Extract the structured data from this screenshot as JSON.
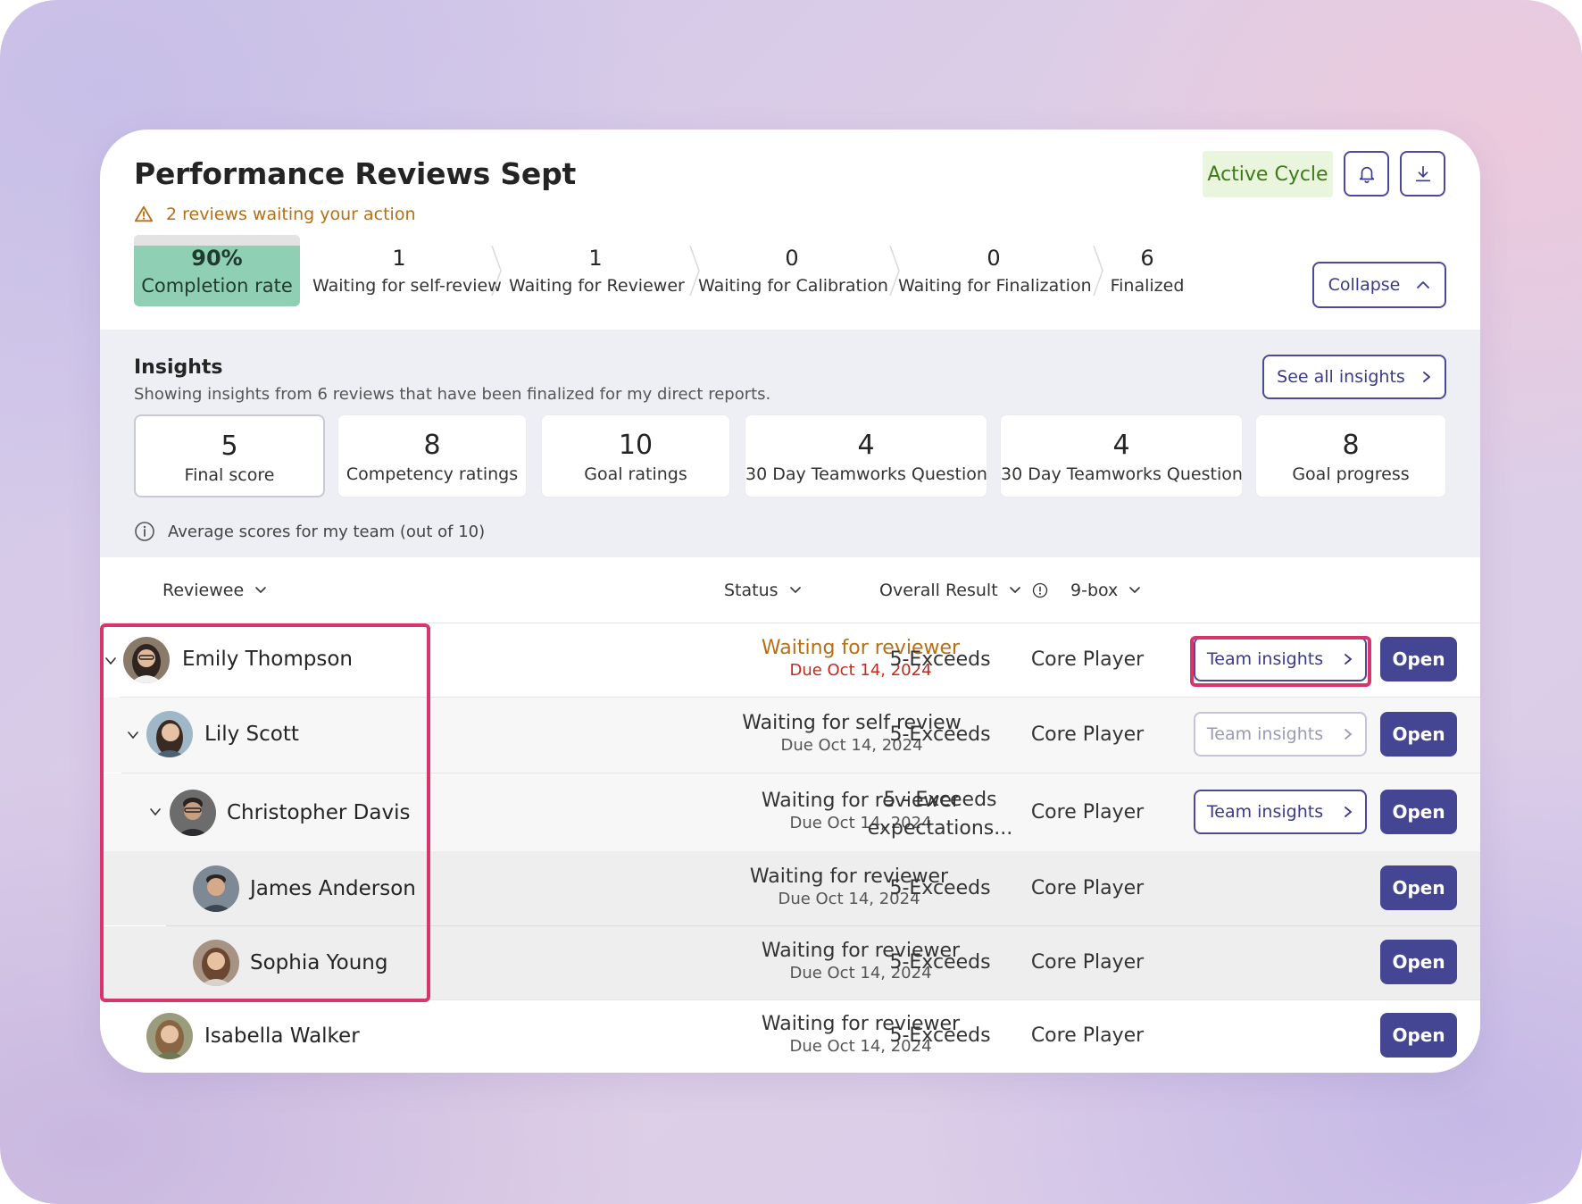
{
  "header": {
    "title": "Performance Reviews Sept",
    "warning": "2 reviews waiting your action",
    "active_cycle": "Active Cycle",
    "bell_icon": "bell-icon",
    "download_icon": "download-icon",
    "collapse_label": "Collapse"
  },
  "colors": {
    "accent": "#444593",
    "completion": "#8fcfb3",
    "warning": "#b86e14",
    "due_overdue": "#c22b1c",
    "highlight": "#d8356b",
    "active_cycle_bg": "#e9f5dd"
  },
  "summary": {
    "completion_value": "90%",
    "completion_label": "Completion rate",
    "stages": [
      {
        "count": "1",
        "label": "Waiting for self-review"
      },
      {
        "count": "1",
        "label": "Waiting for Reviewer"
      },
      {
        "count": "0",
        "label": "Waiting for Calibration"
      },
      {
        "count": "0",
        "label": "Waiting for Finalization"
      },
      {
        "count": "6",
        "label": "Finalized"
      }
    ]
  },
  "insights": {
    "title": "Insights",
    "subtitle": "Showing insights from 6 reviews that have been finalized for my direct reports.",
    "see_all": "See all insights",
    "note": "Average scores for my team (out of 10)",
    "cards": [
      {
        "value": "5",
        "label": "Final score"
      },
      {
        "value": "8",
        "label": "Competency ratings"
      },
      {
        "value": "10",
        "label": "Goal ratings"
      },
      {
        "value": "4",
        "label": "30 Day Teamworks Question"
      },
      {
        "value": "4",
        "label": "30 Day Teamworks Question"
      },
      {
        "value": "8",
        "label": "Goal progress"
      }
    ]
  },
  "table": {
    "columns": {
      "reviewee": "Reviewee",
      "status": "Status",
      "result": "Overall Result",
      "ninebox": "9-box"
    },
    "team_insights_label": "Team insights",
    "open_label": "Open",
    "rows": [
      {
        "name": "Emily Thompson",
        "status": "Waiting for reviewer",
        "due": "Due Oct 14, 2024",
        "result": "5-Exceeds",
        "ninebox": "Core Player"
      },
      {
        "name": "Lily Scott",
        "status": "Waiting for self review",
        "due": "Due Oct 14, 2024",
        "result": "5-Exceeds",
        "ninebox": "Core Player"
      },
      {
        "name": "Christopher Davis",
        "status": "Waiting for reviewer",
        "due": "Due Oct 14, 2024",
        "result_line1": "5 - Exceeds",
        "result_line2": "expectations...",
        "ninebox": "Core Player"
      },
      {
        "name": "James Anderson",
        "status": "Waiting for reviewer",
        "due": "Due Oct 14, 2024",
        "result": "5-Exceeds",
        "ninebox": "Core Player"
      },
      {
        "name": "Sophia Young",
        "status": "Waiting for reviewer",
        "due": "Due Oct 14, 2024",
        "result": "5-Exceeds",
        "ninebox": "Core Player"
      },
      {
        "name": "Isabella Walker",
        "status": "Waiting for reviewer",
        "due": "Due Oct 14, 2024",
        "result": "5-Exceeds",
        "ninebox": "Core Player"
      }
    ]
  }
}
